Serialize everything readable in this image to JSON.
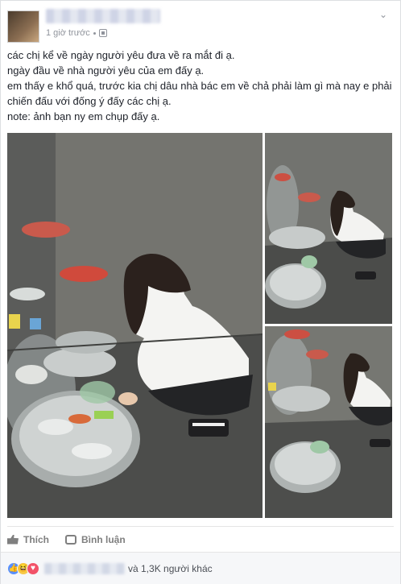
{
  "post": {
    "timestamp": "1 giờ trước",
    "text_lines": [
      "các chị kể về ngày người yêu đưa về ra mắt đi ạ.",
      "ngày đầu về nhà người yêu của em đấy ạ.",
      "em thấy e khổ quá, trước kia chị dâu nhà bác em về chả phải làm gì mà nay e phải chiến đấu với đống ý đấy các chị ạ.",
      "note: ảnh bạn ny em chụp đấy ạ."
    ]
  },
  "actions": {
    "like_label": "Thích",
    "comment_label": "Bình luận"
  },
  "reactions": {
    "summary_suffix": "và 1,3K người khác",
    "types": [
      "like-icon",
      "haha-icon",
      "love-icon"
    ]
  },
  "colors": {
    "accent": "#4267b2",
    "like": "#5890ff",
    "love": "#f25268",
    "haha": "#f7c947"
  }
}
